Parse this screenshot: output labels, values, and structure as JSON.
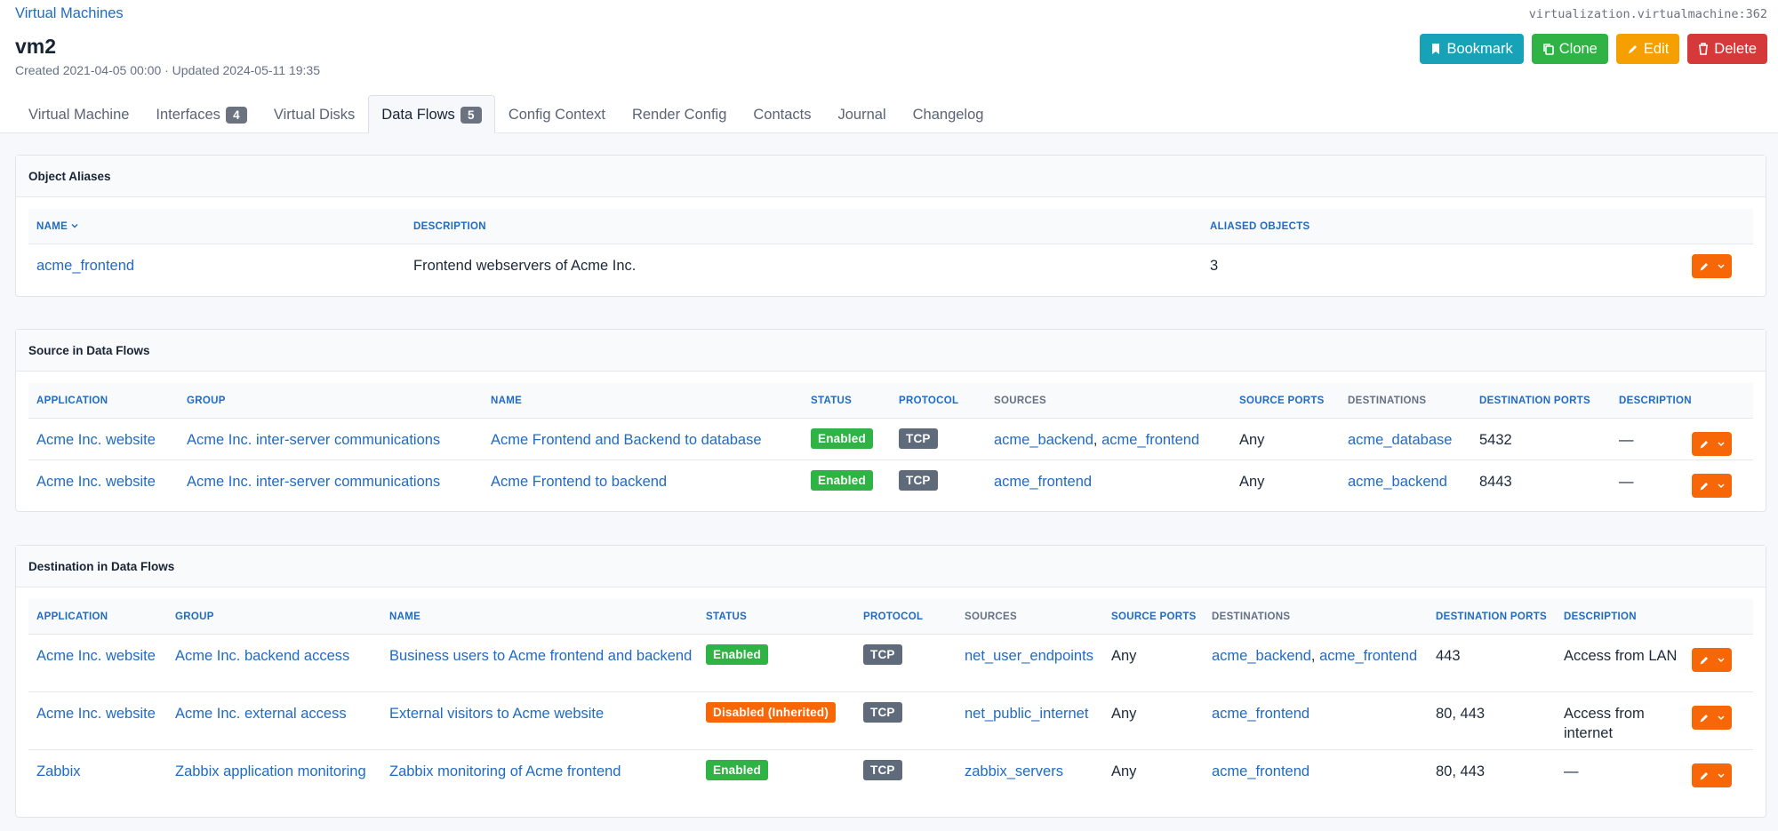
{
  "breadcrumb": "Virtual Machines",
  "object_id": "virtualization.virtualmachine:362",
  "title": "vm2",
  "meta": "Created 2021-04-05 00:00 · Updated 2024-05-11 19:35",
  "actions": {
    "bookmark": "Bookmark",
    "clone": "Clone",
    "edit": "Edit",
    "delete": "Delete"
  },
  "tabs": [
    {
      "label": "Virtual Machine"
    },
    {
      "label": "Interfaces",
      "badge": "4"
    },
    {
      "label": "Virtual Disks"
    },
    {
      "label": "Data Flows",
      "badge": "5",
      "active": true
    },
    {
      "label": "Config Context"
    },
    {
      "label": "Render Config"
    },
    {
      "label": "Contacts"
    },
    {
      "label": "Journal"
    },
    {
      "label": "Changelog"
    }
  ],
  "aliases": {
    "title": "Object Aliases",
    "headers": [
      "NAME",
      "DESCRIPTION",
      "ALIASED OBJECTS"
    ],
    "rows": [
      {
        "name": "acme_frontend",
        "description": "Frontend webservers of Acme Inc.",
        "aliased_objects": "3"
      }
    ]
  },
  "source_flows": {
    "title": "Source in Data Flows",
    "headers": [
      "APPLICATION",
      "GROUP",
      "NAME",
      "STATUS",
      "PROTOCOL",
      "SOURCES",
      "SOURCE PORTS",
      "DESTINATIONS",
      "DESTINATION PORTS",
      "DESCRIPTION"
    ],
    "rows": [
      {
        "application": "Acme Inc. website",
        "group": "Acme Inc. inter-server communications",
        "name": "Acme Frontend and Backend to database",
        "status": "Enabled",
        "protocol": "TCP",
        "sources": [
          "acme_backend",
          "acme_frontend"
        ],
        "source_ports": "Any",
        "destinations": [
          "acme_database"
        ],
        "destination_ports": "5432",
        "description": "—"
      },
      {
        "application": "Acme Inc. website",
        "group": "Acme Inc. inter-server communications",
        "name": "Acme Frontend to backend",
        "status": "Enabled",
        "protocol": "TCP",
        "sources": [
          "acme_frontend"
        ],
        "source_ports": "Any",
        "destinations": [
          "acme_backend"
        ],
        "destination_ports": "8443",
        "description": "—"
      }
    ]
  },
  "dest_flows": {
    "title": "Destination in Data Flows",
    "headers": [
      "APPLICATION",
      "GROUP",
      "NAME",
      "STATUS",
      "PROTOCOL",
      "SOURCES",
      "SOURCE PORTS",
      "DESTINATIONS",
      "DESTINATION PORTS",
      "DESCRIPTION"
    ],
    "rows": [
      {
        "application": "Acme Inc. website",
        "group": "Acme Inc. backend access",
        "name": "Business users to Acme frontend and backend",
        "status": "Enabled",
        "protocol": "TCP",
        "sources": [
          "net_user_endpoints"
        ],
        "source_ports": "Any",
        "destinations": [
          "acme_backend",
          "acme_frontend"
        ],
        "destination_ports": "443",
        "description": "Access from LAN"
      },
      {
        "application": "Acme Inc. website",
        "group": "Acme Inc. external access",
        "name": "External visitors to Acme website",
        "status": "Disabled (Inherited)",
        "protocol": "TCP",
        "sources": [
          "net_public_internet"
        ],
        "source_ports": "Any",
        "destinations": [
          "acme_frontend"
        ],
        "destination_ports": "80, 443",
        "description": "Access from internet"
      },
      {
        "application": "Zabbix",
        "group": "Zabbix application monitoring",
        "name": "Zabbix monitoring of Acme frontend",
        "status": "Enabled",
        "protocol": "TCP",
        "sources": [
          "zabbix_servers"
        ],
        "source_ports": "Any",
        "destinations": [
          "acme_frontend"
        ],
        "destination_ports": "80, 443",
        "description": "—"
      }
    ]
  },
  "colors": {
    "link": "#206bc4",
    "enabled": "#2fb344",
    "disabled": "#f76707",
    "protocol": "#5f6b7a",
    "bookmark": "#17a2b8",
    "clone": "#2fb344",
    "edit": "#f59f00",
    "delete": "#d63939"
  },
  "icons": {
    "bookmark": "bookmark-icon",
    "clone": "copy-icon",
    "edit": "pencil-icon",
    "delete": "trash-icon",
    "sort": "chevron-down-icon",
    "row_menu": "chevron-down-icon"
  }
}
